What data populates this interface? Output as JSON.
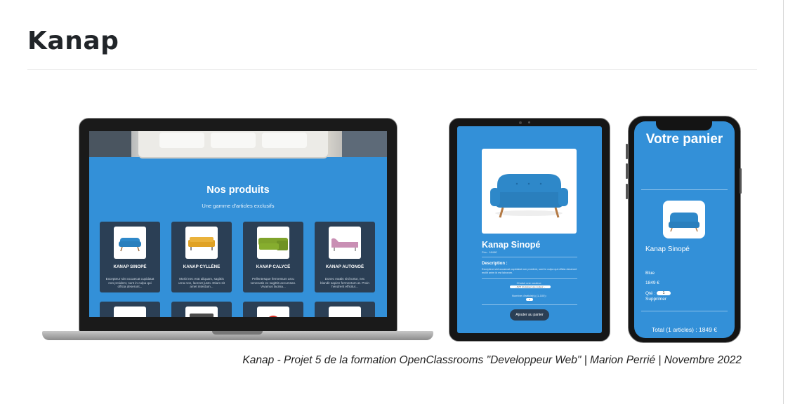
{
  "page": {
    "title": "Kanap",
    "caption": "Kanap - Projet 5 de la formation OpenClassrooms  \"Developpeur Web\" | Marion Perrié | Novembre 2022"
  },
  "laptop": {
    "heading": "Nos produits",
    "subheading": "Une gamme d'articles exclusifs",
    "products": [
      {
        "name": "KANAP SINOPÉ",
        "desc": "Excepteur sint occaecat cupidatat non proident, sunt in culpa qui officia deserunt...",
        "color": "#2e88c9"
      },
      {
        "name": "KANAP CYLLÈNE",
        "desc": "Morbi nec erat aliquam, sagittis urna non, laoreet justo. Etiam sit amet interdum...",
        "color": "#e0a225"
      },
      {
        "name": "KANAP CALYCÉ",
        "desc": "Pellentesque fermentum arcu venenatis ex sagittis accumsan. Vivamus lacinia...",
        "color": "#7fa32b"
      },
      {
        "name": "KANAP AUTONOÉ",
        "desc": "Donec mattis nisl tortor, nec blandit sapien fermentum at. Proin hendrerit efficitur...",
        "color": "#c98fb4"
      }
    ]
  },
  "tablet": {
    "product_name": "Kanap Sinopé",
    "price": "Prix : 1849€",
    "description_heading": "Description :",
    "description": "Excepteur sint occaecat cupidatat non proident, sunt in culpa qui officia deserunt mollit anim id est laborum.",
    "color_label": "Choisir une couleur :",
    "color_select": "--SVP, choisissez une couleur --",
    "qty_label": "Nombre d'article(s) (1-100) :",
    "qty_value": "0",
    "add_button": "Ajouter au panier"
  },
  "phone": {
    "title": "Votre panier",
    "item_name": "Kanap Sinopé",
    "color": "Blue",
    "price": "1849 €",
    "qty_label": "Qté :",
    "qty_value": "1",
    "delete": "Supprimer",
    "total": "Total (1 articles) : 1849 €"
  },
  "colors": {
    "accent_blue": "#3390d8",
    "card_dark": "#2b3f55"
  }
}
